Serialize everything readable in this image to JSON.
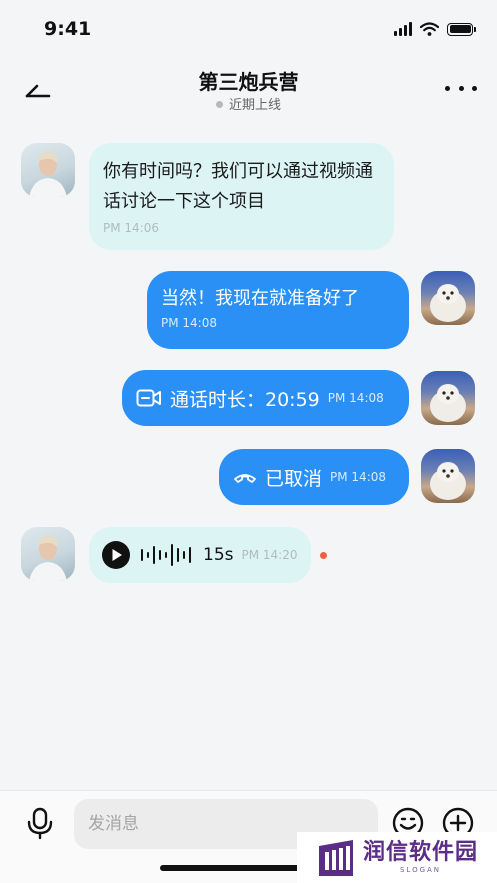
{
  "status": {
    "time": "9:41"
  },
  "header": {
    "title": "第三炮兵营",
    "status": "近期上线"
  },
  "messages": [
    {
      "text": "你有时间吗？我们可以通过视频通话讨论一下这个项目",
      "time": "PM 14:06"
    },
    {
      "text": "当然！我现在就准备好了",
      "time": "PM 14:08"
    },
    {
      "label": "通话时长：20:59",
      "time": "PM 14:08"
    },
    {
      "label": "已取消",
      "time": "PM 14:08"
    },
    {
      "duration": "15s",
      "time": "PM 14:20"
    }
  ],
  "input": {
    "placeholder": "发消息"
  },
  "watermark": {
    "name": "润信软件园",
    "slogan": "SLOGAN"
  },
  "colors": {
    "accent": "#2b90f5",
    "incoming_bubble": "#dcf5f4",
    "unread_dot": "#f2603c"
  }
}
